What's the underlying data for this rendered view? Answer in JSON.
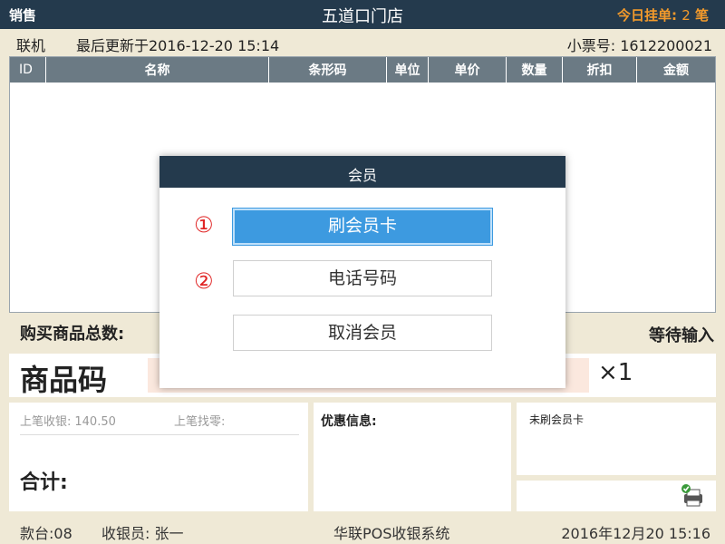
{
  "topbar": {
    "mode": "销售",
    "store_name": "五道口门店",
    "pending_label": "今日挂单:",
    "pending_count": "2",
    "pending_unit": "笔"
  },
  "status": {
    "connection": "联机",
    "last_update": "最后更新于2016-12-20 15:14",
    "ticket_no": "小票号: 1612200021"
  },
  "table": {
    "columns": [
      "ID",
      "名称",
      "条形码",
      "单位",
      "单价",
      "数量",
      "折扣",
      "金额"
    ],
    "rows": []
  },
  "summary": {
    "total_items_label": "购买商品总数:",
    "waiting": "等待输入"
  },
  "code_entry": {
    "label": "商品码",
    "value": "",
    "qty": "×1"
  },
  "totals": {
    "last_paid_label": "上笔收银:",
    "last_paid_value": "140.50",
    "last_change_label": "上笔找零:",
    "sum_label": "合计:"
  },
  "promo": {
    "label": "优惠信息:"
  },
  "member_status": {
    "label": "未刷会员卡"
  },
  "footer": {
    "register": "款台:08",
    "cashier": "收银员: 张一",
    "system": "华联POS收银系统",
    "datetime": "2016年12月20  15:16"
  },
  "dialog": {
    "title": "会员",
    "marker_1": "①",
    "marker_2": "②",
    "swipe_card": "刷会员卡",
    "phone_number": "电话号码",
    "cancel_member": "取消会员"
  },
  "colors": {
    "header_bg": "#243a4d",
    "accent_orange": "#f39a2b",
    "primary_blue": "#3d9ae0",
    "marker_red": "#e02424",
    "page_bg": "#efe9d6"
  }
}
